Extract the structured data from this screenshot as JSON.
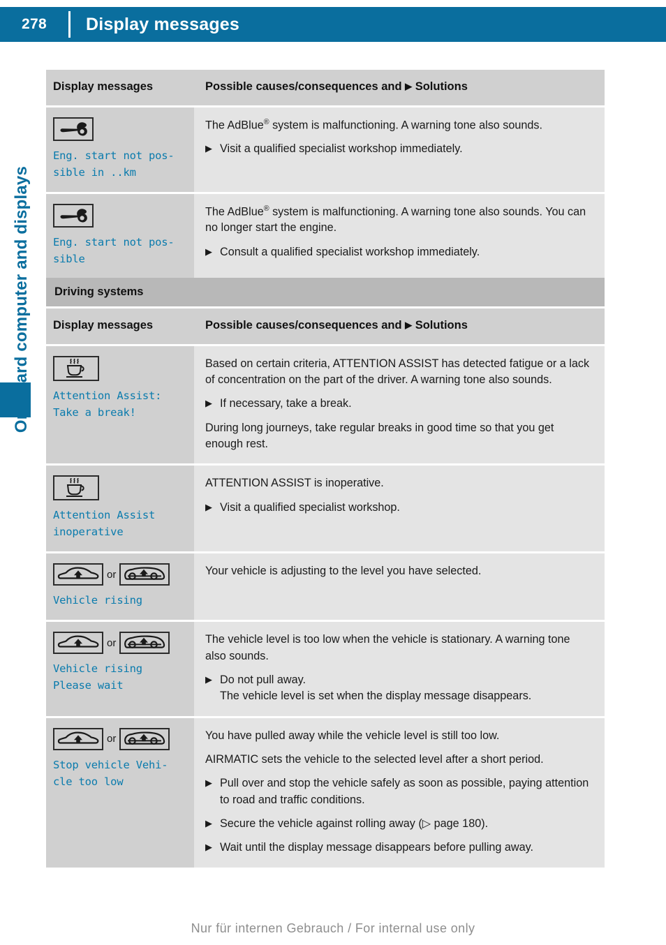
{
  "header": {
    "page_number": "278",
    "title": "Display messages"
  },
  "sidebar": {
    "chapter_title": "On-board computer and displays"
  },
  "table1": {
    "columns": {
      "left": "Display messages",
      "right_pre": "Possible causes/consequences and",
      "right_post": "Solutions"
    },
    "rows": [
      {
        "icon": "wrench-icon",
        "message": "Eng. start not pos-\nsible in ..km",
        "paragraphs": [
          "The AdBlue® system is malfunctioning. A warning tone also sounds."
        ],
        "steps": [
          {
            "text": "Visit a qualified specialist workshop immediately."
          }
        ]
      },
      {
        "icon": "wrench-icon",
        "message": "Eng. start not pos-\nsible",
        "paragraphs": [
          "The AdBlue® system is malfunctioning. A warning tone also sounds. You can no longer start the engine."
        ],
        "steps": [
          {
            "text": "Consult a qualified specialist workshop immediately."
          }
        ]
      }
    ]
  },
  "table2": {
    "section_title": "Driving systems",
    "columns": {
      "left": "Display messages",
      "right_pre": "Possible causes/consequences and",
      "right_post": "Solutions"
    },
    "rows": [
      {
        "icon": "coffee-cup-icon",
        "message": "Attention Assist:\nTake a break!",
        "blocks": [
          {
            "kind": "para",
            "text": "Based on certain criteria, ATTENTION ASSIST has detected fatigue or a lack of concentration on the part of the driver. A warning tone also sounds."
          },
          {
            "kind": "step",
            "text": "If necessary, take a break."
          },
          {
            "kind": "para",
            "text": "During long journeys, take regular breaks in good time so that you get enough rest."
          }
        ]
      },
      {
        "icon": "coffee-cup-icon",
        "message": "Attention Assist\ninoperative",
        "blocks": [
          {
            "kind": "para",
            "text": "ATTENTION ASSIST is inoperative."
          },
          {
            "kind": "step",
            "text": "Visit a qualified specialist workshop."
          }
        ]
      },
      {
        "icon": "vehicle-rising-pair",
        "or_label": "or",
        "message": "Vehicle rising",
        "blocks": [
          {
            "kind": "para",
            "text": "Your vehicle is adjusting to the level you have selected."
          }
        ]
      },
      {
        "icon": "vehicle-rising-pair",
        "or_label": "or",
        "message": "Vehicle rising\nPlease wait",
        "blocks": [
          {
            "kind": "para",
            "text": "The vehicle level is too low when the vehicle is stationary. A warning tone also sounds."
          },
          {
            "kind": "step",
            "text": "Do not pull away.",
            "sub": "The vehicle level is set when the display message disappears."
          }
        ]
      },
      {
        "icon": "vehicle-rising-pair",
        "or_label": "or",
        "message": " Stop vehicle Vehi-\ncle too low",
        "blocks": [
          {
            "kind": "para",
            "text": "You have pulled away while the vehicle level is still too low."
          },
          {
            "kind": "para",
            "text": "AIRMATIC sets the vehicle to the selected level after a short period."
          },
          {
            "kind": "step",
            "text": "Pull over and stop the vehicle safely as soon as possible, paying attention to road and traffic conditions."
          },
          {
            "kind": "step",
            "text": "Secure the vehicle against rolling away (▷ page 180)."
          },
          {
            "kind": "step",
            "text": "Wait until the display message disappears before pulling away."
          }
        ]
      }
    ]
  },
  "footer": {
    "text": "Nur für internen Gebrauch / For internal use only"
  },
  "colors": {
    "brand_blue": "#0a6e9e",
    "message_blue": "#0a7bad",
    "header_gray": "#d0d0d0",
    "band_gray": "#b8b8b8",
    "body_gray": "#e4e4e4"
  }
}
